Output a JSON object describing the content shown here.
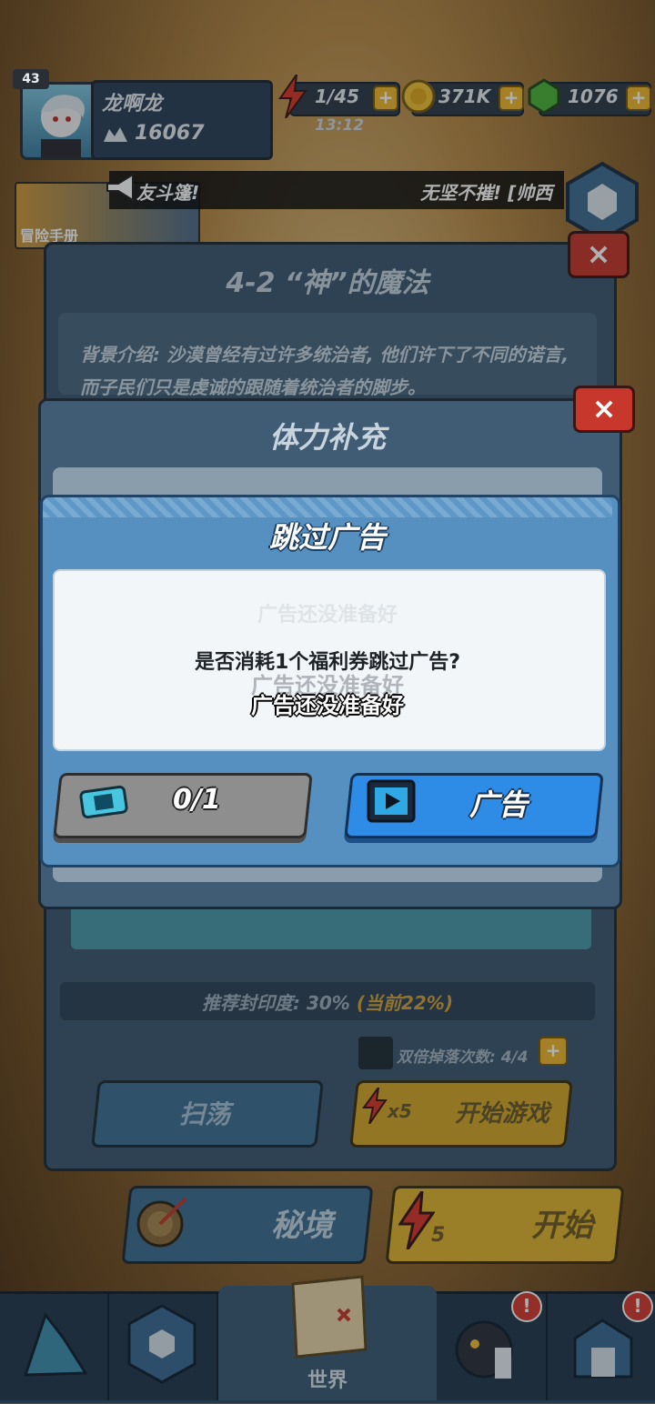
{
  "player": {
    "level": "43",
    "name": "龙啊龙",
    "power": "16067"
  },
  "resources": {
    "stamina": "1/45",
    "stamina_timer": "13:12",
    "gold": "371K",
    "gems": "1076"
  },
  "ticker": {
    "left_text": "友斗篷!",
    "right_text": "无坚不摧! [帅西"
  },
  "handbook": {
    "label": "冒险手册"
  },
  "stage": {
    "title": "4-2 “神”的魔法",
    "description": "背景介绍: 沙漠曾经有过许多统治者, 他们许下了不同的诺言, 而子民们只是虔诚的跟随着统治者的脚步。",
    "seal_label": "推荐封印度: 30%",
    "seal_current": "(当前22%)",
    "double_drop": "双倍掉落次数: 4/4",
    "sweep_label": "扫荡",
    "cost_label": "x5",
    "start_game_label": "开始游戏"
  },
  "energy_panel": {
    "title": "体力补充"
  },
  "dialog": {
    "title": "跳过广告",
    "ghost_text": "广告还没准备好",
    "question": "是否消耗1个福利券跳过广告?",
    "toast": "广告还没准备好",
    "voucher_count": "0/1",
    "ad_label": "广告"
  },
  "actions": {
    "secret_label": "秘境",
    "start_label": "开始",
    "start_cost": "5"
  },
  "nav": {
    "world_label": "世界",
    "alert": "!"
  },
  "colors": {
    "gold": "#e2b42e",
    "blue_button": "#2f8ce6",
    "close_red": "#c8372b",
    "energy_red": "#d9352a"
  }
}
